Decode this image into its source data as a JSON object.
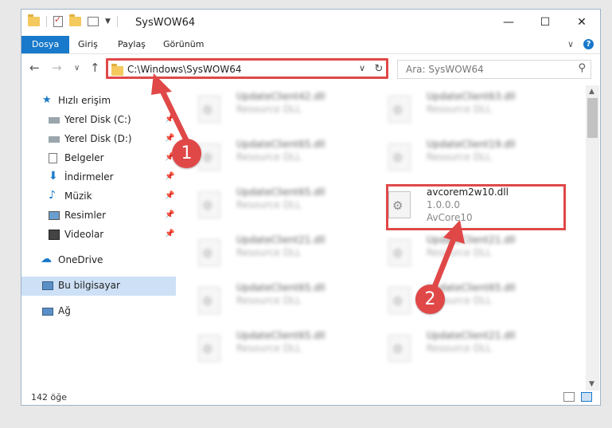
{
  "window": {
    "title": "SysWOW64"
  },
  "window_controls": {
    "minimize": "—",
    "maximize": "☐",
    "close": "✕"
  },
  "ribbon": {
    "tabs": [
      "Dosya",
      "Giriş",
      "Paylaş",
      "Görünüm"
    ],
    "expand": "∨",
    "help": "?"
  },
  "nav": {
    "back": "←",
    "forward": "→",
    "recent": "∨",
    "up": "↑",
    "address": "C:\\Windows\\SysWOW64",
    "address_dropdown": "∨",
    "refresh": "↻",
    "search_placeholder": "Ara: SysWOW64",
    "search_icon": "⚲"
  },
  "sidebar": {
    "items": [
      {
        "label": "Hızlı erişim",
        "icon": "star-icon",
        "pinned": false
      },
      {
        "label": "Yerel Disk (C:)",
        "icon": "drive-icon",
        "pinned": true
      },
      {
        "label": "Yerel Disk (D:)",
        "icon": "drive-icon",
        "pinned": true
      },
      {
        "label": "Belgeler",
        "icon": "documents-icon",
        "pinned": true
      },
      {
        "label": "İndirmeler",
        "icon": "download-icon",
        "pinned": true
      },
      {
        "label": "Müzik",
        "icon": "music-icon",
        "pinned": true
      },
      {
        "label": "Resimler",
        "icon": "pictures-icon",
        "pinned": true
      },
      {
        "label": "Videolar",
        "icon": "videos-icon",
        "pinned": true
      },
      {
        "label": "OneDrive",
        "icon": "cloud-icon",
        "pinned": false
      },
      {
        "label": "Bu bilgisayar",
        "icon": "computer-icon",
        "pinned": false
      },
      {
        "label": "Ağ",
        "icon": "network-icon",
        "pinned": false
      }
    ],
    "pin_glyph": "📌"
  },
  "files": [
    {
      "name": "UpdateClient42.dll",
      "desc": "Resource DLL"
    },
    {
      "name": "UpdateClient63.dll",
      "desc": "Resource DLL"
    },
    {
      "name": "UpdateClient65.dll",
      "desc": "Resource DLL"
    },
    {
      "name": "UpdateClient19.dll",
      "desc": "Resource DLL"
    },
    {
      "name": "UpdateClient65.dll",
      "desc": "Resource DLL"
    },
    {
      "name": "avcorem2w10.dll",
      "version": "1.0.0.0",
      "desc": "AvCore10"
    },
    {
      "name": "UpdateClient21.dll",
      "desc": "Resource DLL"
    },
    {
      "name": "UpdateClient21.dll",
      "desc": "Resource DLL"
    },
    {
      "name": "UpdateClient65.dll",
      "desc": "Resource DLL"
    },
    {
      "name": "UpdateClient65.dll",
      "desc": "Resource DLL"
    },
    {
      "name": "UpdateClient65.dll",
      "desc": "Resource DLL"
    },
    {
      "name": "UpdateClient21.dll",
      "desc": "Resource DLL"
    }
  ],
  "status": {
    "count": "142 öğe"
  },
  "annotations": {
    "step1": "1",
    "step2": "2",
    "color": "#e04848"
  }
}
